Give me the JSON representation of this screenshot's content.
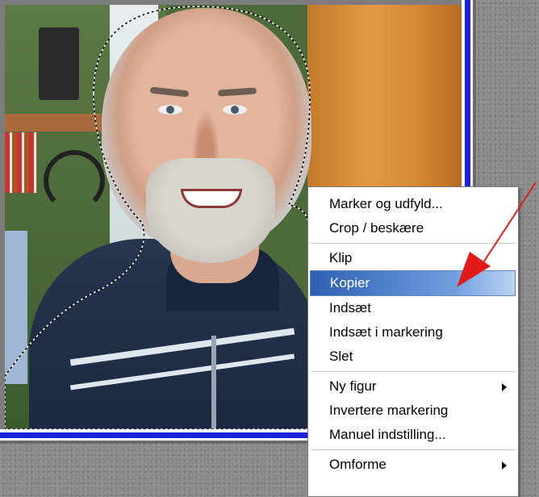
{
  "context_menu": {
    "items": [
      {
        "label": "Marker og udfyld...",
        "has_submenu": false
      },
      {
        "label": "Crop / beskære",
        "has_submenu": false
      },
      {
        "separator": true
      },
      {
        "label": "Klip",
        "has_submenu": false
      },
      {
        "label": "Kopier",
        "has_submenu": false,
        "highlighted": true
      },
      {
        "label": "Indsæt",
        "has_submenu": false
      },
      {
        "label": "Indsæt i markering",
        "has_submenu": false
      },
      {
        "label": "Slet",
        "has_submenu": false
      },
      {
        "separator": true
      },
      {
        "label": "Ny figur",
        "has_submenu": true
      },
      {
        "label": "Invertere markering",
        "has_submenu": false
      },
      {
        "label": "Manuel indstilling...",
        "has_submenu": false
      },
      {
        "separator": true
      },
      {
        "label": "Omforme",
        "has_submenu": true
      }
    ]
  },
  "colors": {
    "highlight": "#3a6cc0",
    "canvas_border_blue": "#1c22d8",
    "annotation_arrow": "#e31a1a"
  },
  "annotation": {
    "icon": "red-arrow-icon"
  }
}
